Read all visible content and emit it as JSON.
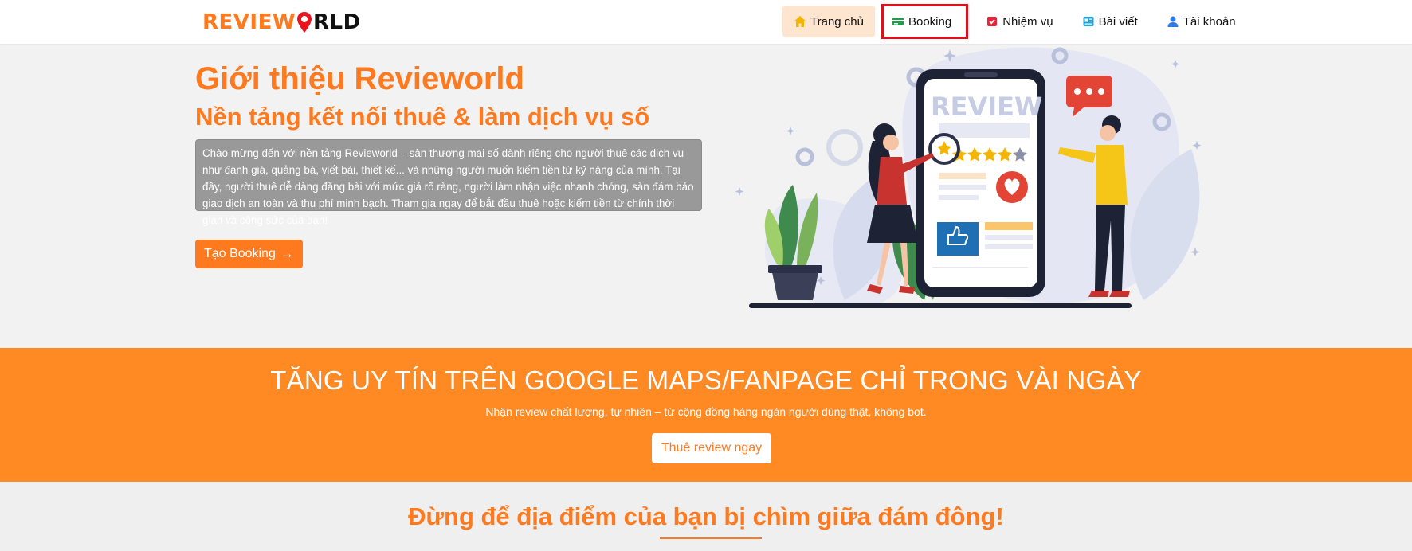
{
  "header": {
    "logo_part1": "REVIEW",
    "logo_part2": "RLD",
    "nav": [
      {
        "label": "Trang chủ",
        "icon": "home-icon"
      },
      {
        "label": "Booking",
        "icon": "card-icon"
      },
      {
        "label": "Nhiệm vụ",
        "icon": "task-icon"
      },
      {
        "label": "Bài viết",
        "icon": "article-icon"
      },
      {
        "label": "Tài khoản",
        "icon": "user-icon"
      }
    ]
  },
  "hero": {
    "title": "Giới thiệu Revieworld",
    "subtitle": "Nền tảng kết nối thuê & làm dịch vụ số",
    "description": "Chào mừng đến với nền tảng Revieworld – sàn thương mại số dành riêng cho người thuê các dịch vụ như đánh giá, quảng bá, viết bài, thiết kế... và những người muốn kiếm tiền từ kỹ năng của mình. Tại đây, người thuê dễ dàng đăng bài với mức giá rõ ràng, người làm nhận việc nhanh chóng, sàn đảm bảo giao dịch an toàn và thu phí minh bạch. Tham gia ngay để bắt đầu thuê hoặc kiếm tiền từ chính thời gian và công sức của bạn!",
    "button_label": "Tạo Booking",
    "illustration_word": "REVIEW"
  },
  "banner": {
    "title": "TĂNG UY TÍN TRÊN GOOGLE MAPS/FANPAGE CHỈ TRONG VÀI NGÀY",
    "subtitle": "Nhận review chất lượng, tự nhiên – từ cộng đồng hàng ngàn người dùng thật, không bot.",
    "button_label": "Thuê review ngay"
  },
  "bottom": {
    "title": "Đừng để địa điểm của bạn bị chìm giữa đám đông!"
  },
  "colors": {
    "brand_orange": "#ff7a1f",
    "banner_orange": "#ff8a23",
    "highlight_red": "#e0101b"
  }
}
